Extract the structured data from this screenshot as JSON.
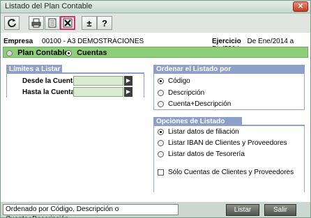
{
  "window": {
    "title": "Listado del Plan Contable"
  },
  "toolbar": {
    "buttons": [
      {
        "name": "refresh-icon"
      },
      {
        "name": "print-icon"
      },
      {
        "name": "preview-icon"
      },
      {
        "name": "excel-export-icon"
      },
      {
        "name": "plus-minus-icon"
      },
      {
        "name": "help-icon"
      }
    ],
    "help_glyph": "?",
    "plusminus_glyph": "±"
  },
  "header": {
    "empresa_label": "Empresa",
    "empresa_value": "00100 - A3 DEMOSTRACIONES",
    "ejercicio_label": "Ejercicio",
    "ejercicio_value": "De Ene/2014 a Dic/2014"
  },
  "mode": {
    "plan_contable": "Plan Contable",
    "cuentas": "Cuentas",
    "selected": "Cuentas"
  },
  "limites": {
    "title": "Límites a Listar",
    "desde_label": "Desde la Cuenta",
    "desde_value": "",
    "hasta_label": "Hasta la Cuenta",
    "hasta_value": ""
  },
  "ordenar": {
    "title": "Ordenar el Listado por",
    "options": [
      "Código",
      "Descripción",
      "Cuenta+Descripción"
    ],
    "selected": "Código"
  },
  "opciones": {
    "title": "Opciones de Listado",
    "radios": [
      "Listar datos de filiación",
      "Listar IBAN de Clientes y Proveedores",
      "Listar datos de Tesorería"
    ],
    "selected": "Listar datos de filiación",
    "checkbox_label": "Sólo Cuentas de Clientes y Proveedores",
    "checkbox_checked": false
  },
  "status": {
    "text": "Ordenado por Código, Descripción o Cuenta+Descripción"
  },
  "actions": {
    "listar": "Listar",
    "salir": "Salir"
  },
  "colors": {
    "accent_green": "#8ccf78",
    "panel_header_blue": "#8fa0c8",
    "close_red": "#c63b24"
  }
}
